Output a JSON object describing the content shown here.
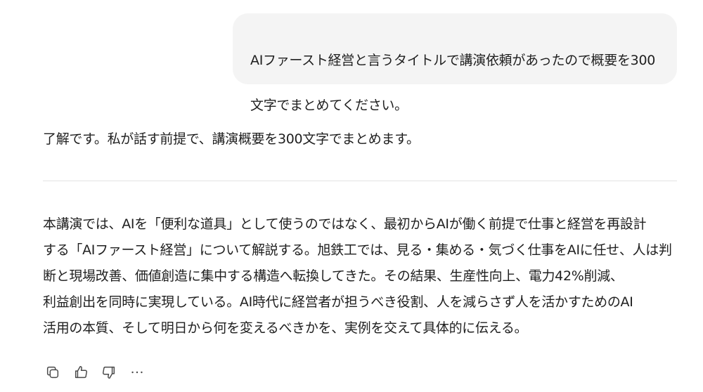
{
  "user_message": {
    "line1": "AIファースト経営と言うタイトルで講演依頼があったので概要を300",
    "line2": "文字でまとめてください。"
  },
  "assistant": {
    "intro": "了解です。私が話す前提で、講演概要を300文字でまとめます。",
    "body_lines": [
      "本講演では、AIを「便利な道具」として使うのではなく、最初からAIが働く前提で仕事と経営を再設計",
      "する「AIファースト経営」について解説する。旭鉄工では、見る・集める・気づく仕事をAIに任せ、人は判",
      "断と現場改善、価値創造に集中する構造へ転換してきた。その結果、生産性向上、電力42%削減、",
      "利益創出を同時に実現している。AI時代に経営者が担うべき役割、人を減らさず人を活かすためのAI",
      "活用の本質、そして明日から何を変えるべきかを、実例を交えて具体的に伝える。"
    ]
  },
  "actions": {
    "copy_icon": "copy-icon",
    "like_icon": "thumbs-up-icon",
    "dislike_icon": "thumbs-down-icon",
    "more_icon": "more-icon"
  }
}
